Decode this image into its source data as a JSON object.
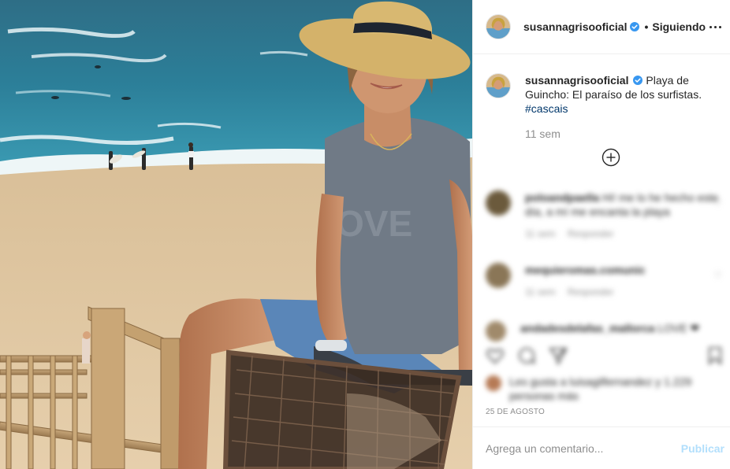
{
  "photo": {
    "alt_description_icon": "post-photo"
  },
  "header": {
    "username": "susannagrisooficial",
    "separator": "•",
    "follow_label": "Siguiendo",
    "more_icon": "more-options-icon"
  },
  "caption": {
    "username": "susannagrisooficial",
    "text": "Playa de Guincho: El paraíso de los surfistas.",
    "hashtag": "#cascais",
    "time": "11 sem"
  },
  "load_more_icon": "plus-circle-icon",
  "comments": [
    {
      "user": "poloandpaella",
      "text": "Hi! me lo he hecho este día, a mí me encanta la playa",
      "meta_time": "11 sem",
      "meta_reply": "Responder"
    },
    {
      "user": "mequieromas.comunic",
      "text": "",
      "meta_time": "11 sem",
      "meta_reply": "Responder"
    },
    {
      "user": "andadesdelafas_mallorca",
      "text": "LOVE ❤",
      "meta_time": "",
      "meta_reply": ""
    }
  ],
  "likes": {
    "text": "Les gusta a luisagilfernandez y 1.229 personas más"
  },
  "date": "25 de agosto",
  "add_comment": {
    "placeholder": "Agrega un comentario...",
    "publish_label": "Publicar"
  },
  "colors": {
    "link": "#00376b",
    "verified": "#3897f0",
    "publish_disabled": "#b2dffc",
    "meta_gray": "#8e8e8e"
  }
}
